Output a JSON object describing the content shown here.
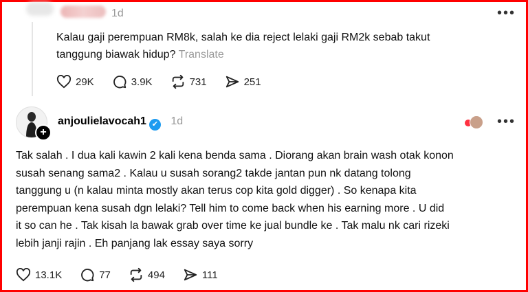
{
  "post": {
    "time": "1d",
    "text_line1": "Kalau gaji perempuan RM8k, salah ke dia reject lelaki gaji RM2k sebab takut",
    "text_line2": "tanggung biawak hidup?",
    "translate": "Translate",
    "likes": "29K",
    "comments": "3.9K",
    "reposts": "731",
    "shares": "251"
  },
  "reply": {
    "username": "anjoulielavocah1",
    "time": "1d",
    "lines": [
      "Tak salah . I dua kali kawin 2 kali kena benda sama . Diorang akan brain wash otak konon",
      "susah senang sama2 . Kalau u susah sorang2 takde jantan pun nk datang tolong",
      "tanggung u (n kalau minta mostly akan terus cop kita gold digger) . So kenapa kita",
      "perempuan kena susah dgn lelaki? Tell him to come back when his earning more . U did",
      "it so can he . Tak kisah la bawak grab over time ke jual bundle ke . Tak malu nk cari rizeki",
      "lebih janji rajin . Eh panjang lak essay saya sorry"
    ],
    "likes": "13.1K",
    "comments": "77",
    "reposts": "494",
    "shares": "111"
  },
  "icons": {
    "like": "heart-icon",
    "comment": "comment-icon",
    "repost": "repost-icon",
    "share": "share-icon",
    "more": "more-icon"
  },
  "colors": {
    "frame": "#ff0000",
    "verified": "#1d9bf0",
    "muted": "#999999"
  }
}
